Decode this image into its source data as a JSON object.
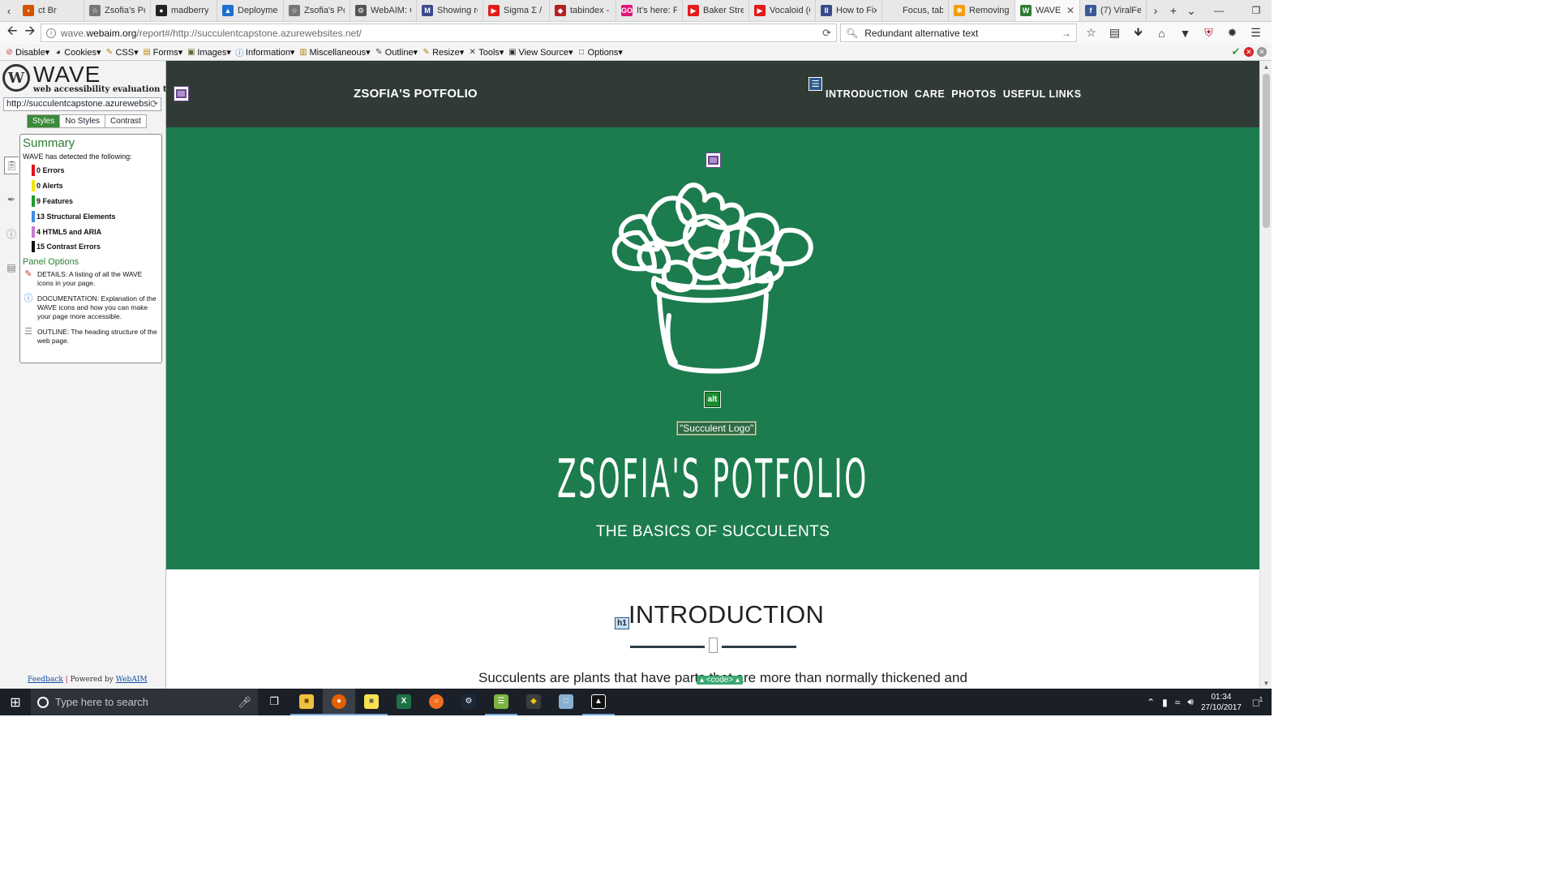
{
  "tabs": [
    {
      "label": "ct Br",
      "fav": "•",
      "fav_color": "#d35400"
    },
    {
      "label": "Zsofia's Po",
      "fav": "☆",
      "fav_color": "#777"
    },
    {
      "label": "madberry",
      "fav": "●",
      "fav_color": "#222"
    },
    {
      "label": "Deployme",
      "fav": "▲",
      "fav_color": "#1e6fd1"
    },
    {
      "label": "Zsofia's Po",
      "fav": "☆",
      "fav_color": "#777"
    },
    {
      "label": "WebAIM: C",
      "fav": "⚙",
      "fav_color": "#555"
    },
    {
      "label": "Showing re",
      "fav": "M",
      "fav_color": "#3b4a8a"
    },
    {
      "label": "Sigma Σ / F",
      "fav": "▶",
      "fav_color": "#e21b1b"
    },
    {
      "label": "tabindex -",
      "fav": "◆",
      "fav_color": "#b52020"
    },
    {
      "label": "It's here: FA",
      "fav": "GO",
      "fav_color": "#e0157a"
    },
    {
      "label": "Baker Stree",
      "fav": "▶",
      "fav_color": "#e21b1b"
    },
    {
      "label": "Vocaloid (C",
      "fav": "▶",
      "fav_color": "#e21b1b"
    },
    {
      "label": "How to Fix",
      "fav": "II",
      "fav_color": "#3b4a8a"
    },
    {
      "label": "Focus, tabInde",
      "fav": "",
      "fav_color": "#e8e8e8"
    },
    {
      "label": "Removing",
      "fav": "✱",
      "fav_color": "#f39c12"
    },
    {
      "label": "WAVE R",
      "fav": "W",
      "fav_color": "#2e7d32",
      "active": true
    },
    {
      "label": "(7) ViralFe",
      "fav": "f",
      "fav_color": "#3b5998"
    }
  ],
  "nav": {
    "url_prefix": "wave.",
    "url_host": "webaim.org",
    "url_rest": "/report#/http://succulentcapstone.azurewebsites.net/",
    "search_value": "Redundant alternative text"
  },
  "toolbar": {
    "items": [
      "Disable▾",
      "Cookies▾",
      "CSS▾",
      "Forms▾",
      "Images▾",
      "Information▾",
      "Miscellaneous▾",
      "Outline▾",
      "Resize▾",
      "Tools▾",
      "View Source▾",
      "Options▾"
    ],
    "icons": [
      "⊘",
      "◕",
      "✎",
      "▤",
      "▣",
      "ⓘ",
      "▥",
      "✎",
      "✎",
      "✕",
      "▣",
      "□"
    ],
    "icon_colors": [
      "#c0392b",
      "#222",
      "#b8860b",
      "#b8860b",
      "#556b2f",
      "#1e6fd1",
      "#b8860b",
      "#444",
      "#b8860b",
      "#333",
      "#333",
      "#333"
    ]
  },
  "wave": {
    "logo_letter": "W",
    "name": "WAVE",
    "tagline": "web accessibility evaluation tool",
    "url": "http://succulentcapstone.azurewebsite",
    "view_styles": "Styles",
    "view_no_styles": "No Styles",
    "view_contrast": "Contrast",
    "summary_title": "Summary",
    "detected": "WAVE has detected the following:",
    "summary": [
      {
        "label": "0 Errors",
        "color": "#e0141b"
      },
      {
        "label": "0 Alerts",
        "color": "#f2e600"
      },
      {
        "label": "9 Features",
        "color": "#1f9d2e"
      },
      {
        "label": "13 Structural Elements",
        "color": "#3d8fdc"
      },
      {
        "label": "4 HTML5 and ARIA",
        "color": "#c77ccf"
      },
      {
        "label": "15 Contrast Errors",
        "color": "#111111"
      }
    ],
    "panel_options_title": "Panel Options",
    "options": [
      {
        "icon": "✎",
        "color": "#c0392b",
        "text": "DETAILS: A listing of all the WAVE icons in your page."
      },
      {
        "icon": "ⓘ",
        "color": "#1e6fd1",
        "text": "DOCUMENTATION: Explanation of the WAVE icons and how you can make your page more accessible."
      },
      {
        "icon": "☰",
        "color": "#888",
        "text": "OUTLINE: The heading structure of the web page."
      }
    ],
    "feedback": "Feedback",
    "powered_by": "Powered by",
    "webaim": "WebAIM"
  },
  "site": {
    "brand": "ZSOFIA'S POTFOLIO",
    "nav": [
      "INTRODUCTION",
      "CARE",
      "PHOTOS",
      "USEFUL LINKS"
    ],
    "alt_badge": "alt",
    "alt_text": "\"Succulent Logo\"",
    "hero_title": "ZSOFIA'S POTFOLIO",
    "hero_subtitle": "THE BASICS OF SUCCULENTS",
    "intro_badge": "h1",
    "intro_heading": "INTRODUCTION",
    "intro_para": "Succulents are plants that have parts that are more than normally thickened and",
    "code_tag": "▴ <code> ▴"
  },
  "taskbar": {
    "search_placeholder": "Type here to search",
    "time": "01:34",
    "date": "27/10/2017",
    "notif_count": "1"
  },
  "colors": {
    "header_bg": "#313b36",
    "hero_bg": "#1d7c4e",
    "wave_green": "#2e7d32"
  }
}
